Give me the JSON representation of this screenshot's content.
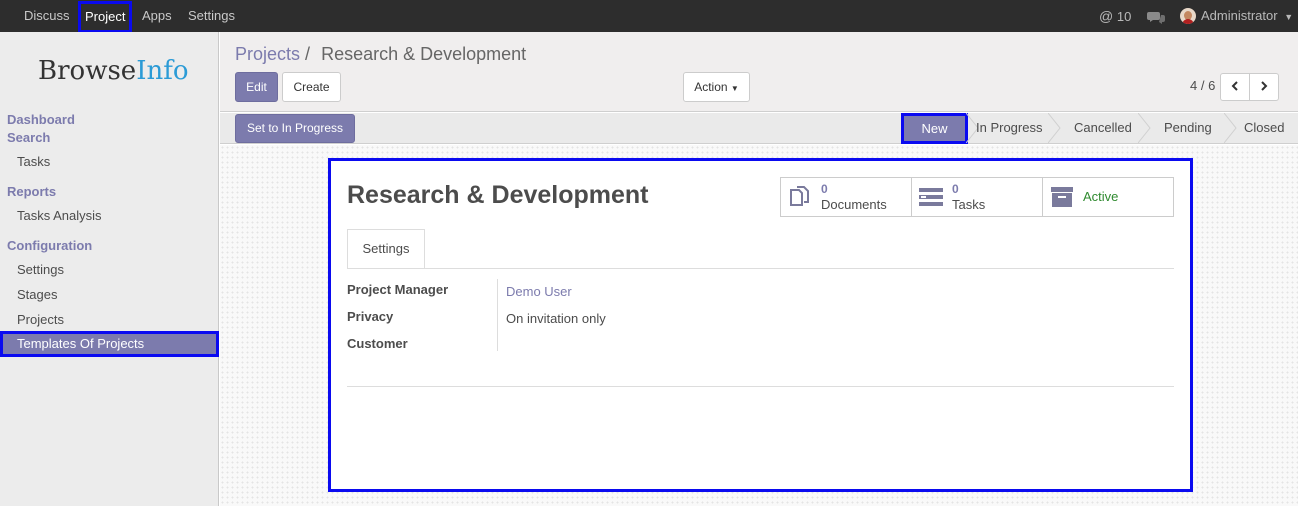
{
  "topbar": {
    "menu": [
      "Discuss",
      "Project",
      "Apps",
      "Settings"
    ],
    "mentions_count": "10",
    "user_name": "Administrator"
  },
  "sidebar": {
    "logo_part1": "Browse",
    "logo_part2": "Info",
    "sections": [
      {
        "title": "Dashboard",
        "items": []
      },
      {
        "title": "Search",
        "items": [
          "Tasks"
        ]
      },
      {
        "title": "Reports",
        "items": [
          "Tasks Analysis"
        ]
      },
      {
        "title": "Configuration",
        "items": [
          "Settings",
          "Stages",
          "Projects",
          "Templates Of Projects"
        ]
      }
    ]
  },
  "control_panel": {
    "breadcrumb_root": "Projects",
    "breadcrumb_sep": "/",
    "breadcrumb_current": "Research & Development",
    "edit_label": "Edit",
    "create_label": "Create",
    "action_label": "Action",
    "pager": "4 / 6"
  },
  "statusbar": {
    "action_button": "Set to In Progress",
    "stages": [
      "New",
      "In Progress",
      "Cancelled",
      "Pending",
      "Closed"
    ],
    "active_stage": "New"
  },
  "form": {
    "title": "Research & Development",
    "stat_buttons": [
      {
        "count": "0",
        "label": "Documents",
        "icon": "documents-icon"
      },
      {
        "count": "0",
        "label": "Tasks",
        "icon": "tasks-icon"
      },
      {
        "label": "Active",
        "icon": "archive-icon"
      }
    ],
    "tab": "Settings",
    "fields": [
      {
        "label": "Project Manager",
        "value": "Demo User"
      },
      {
        "label": "Privacy",
        "value": "On invitation only"
      },
      {
        "label": "Customer",
        "value": ""
      }
    ]
  },
  "colors": {
    "brand": "#7c7bad",
    "highlight": "#0a0af0",
    "navbar": "#2d2d2d",
    "active_green": "#2f8a2f"
  }
}
